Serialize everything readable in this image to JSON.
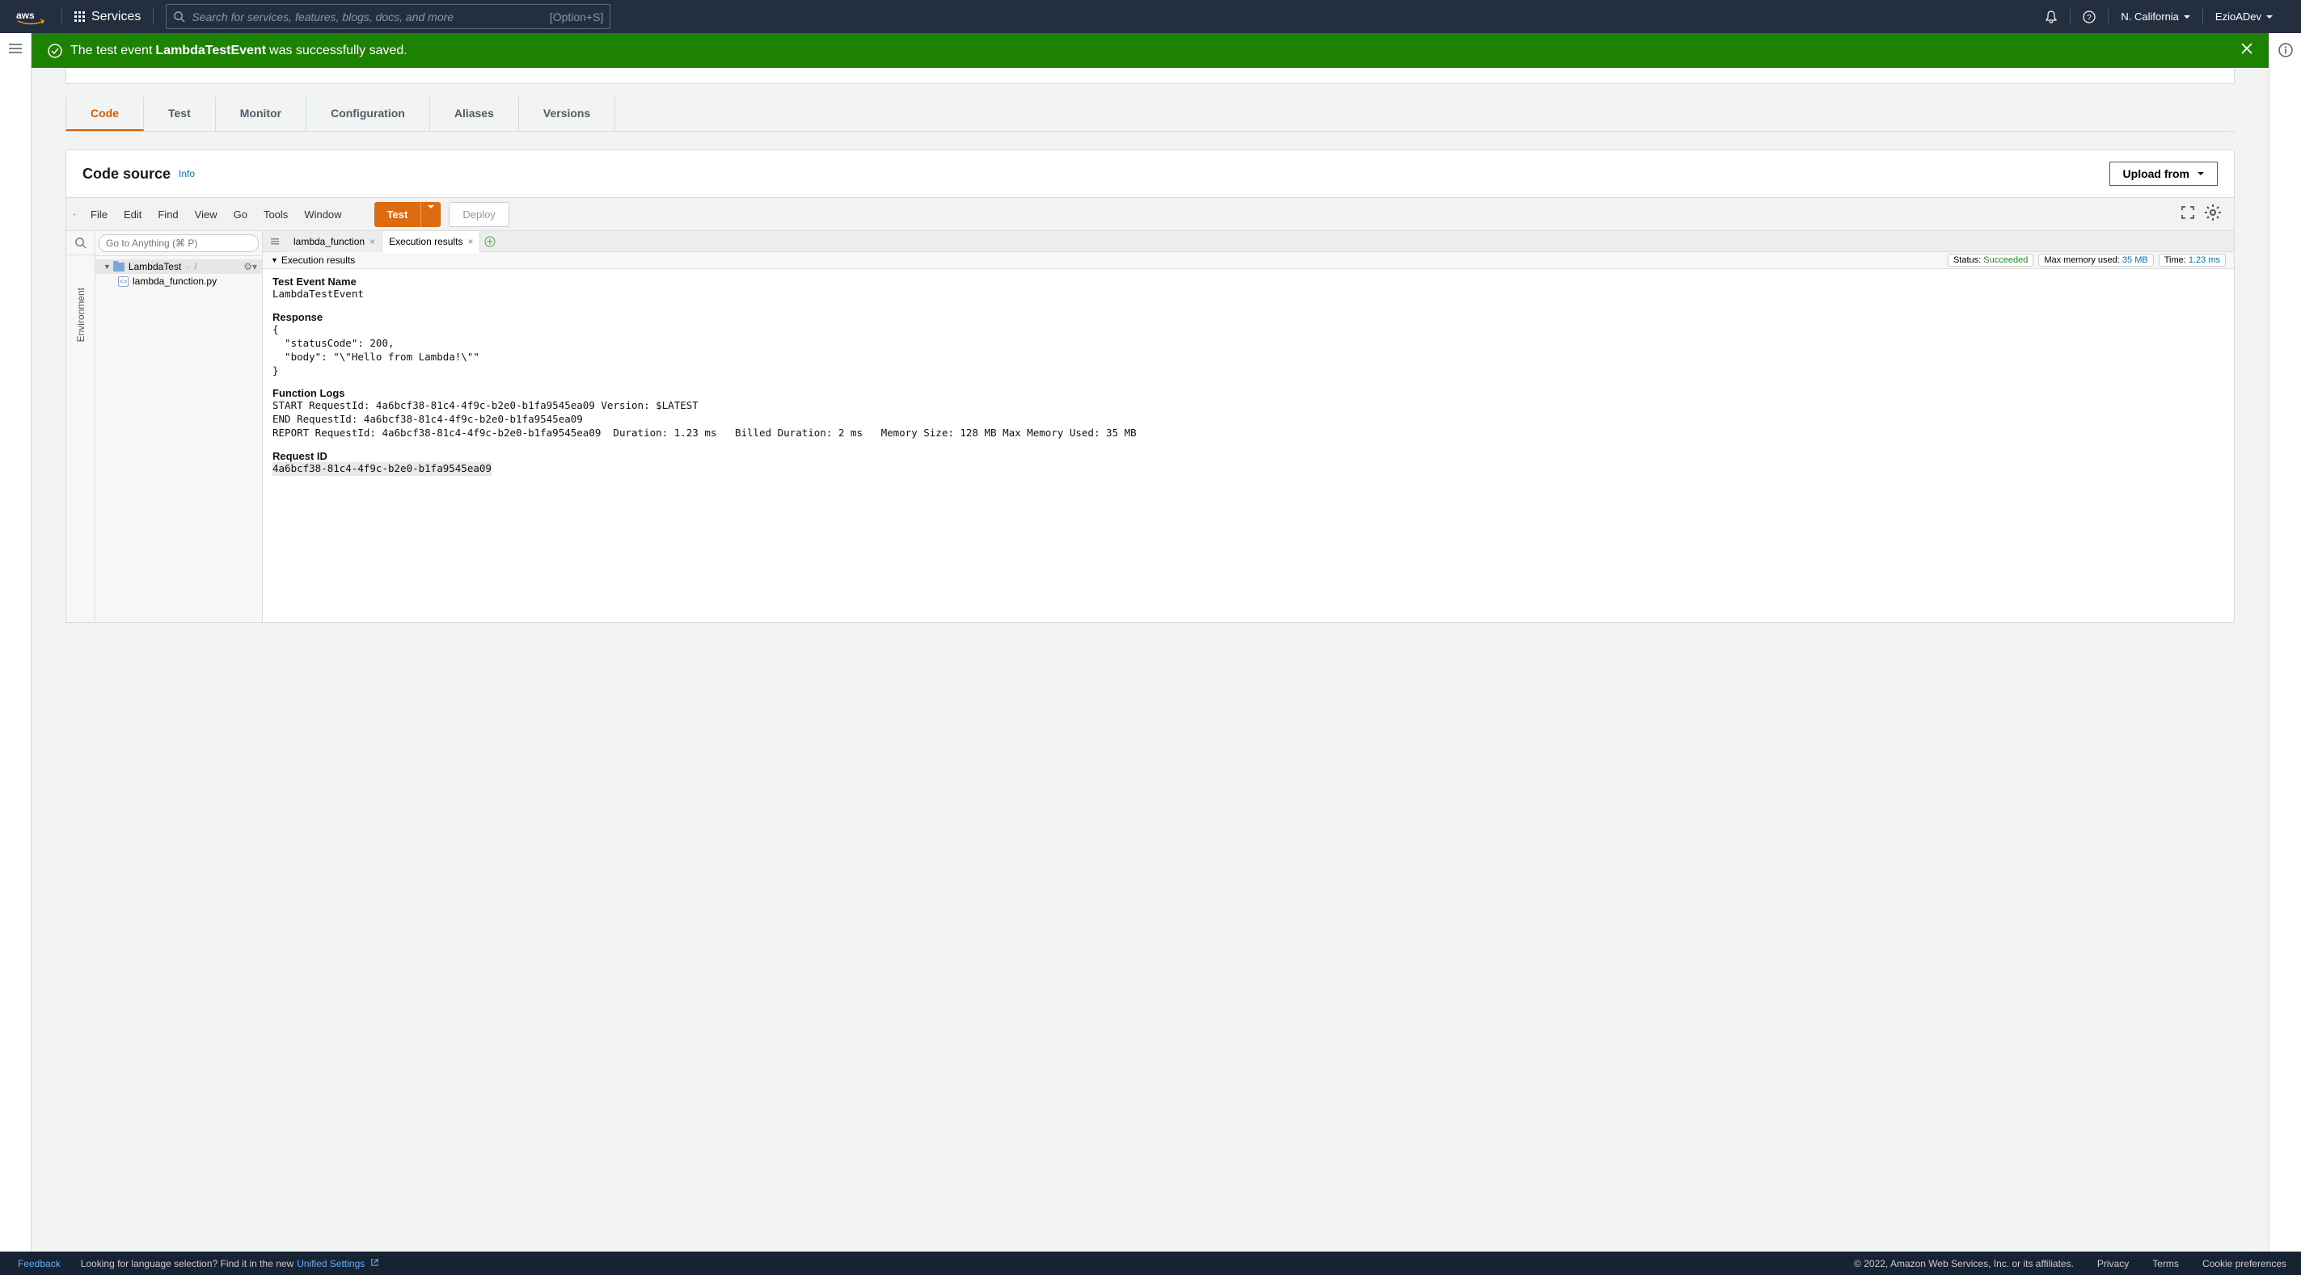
{
  "header": {
    "services_label": "Services",
    "search_placeholder": "Search for services, features, blogs, docs, and more",
    "search_shortcut": "[Option+S]",
    "region": "N. California",
    "account": "EzioADev"
  },
  "flash": {
    "prefix": "The test event ",
    "event_name": "LambdaTestEvent",
    "suffix": " was successfully saved."
  },
  "tabs": {
    "items": [
      "Code",
      "Test",
      "Monitor",
      "Configuration",
      "Aliases",
      "Versions"
    ],
    "active_index": 0
  },
  "code_source": {
    "title": "Code source",
    "info_label": "Info",
    "upload_label": "Upload from"
  },
  "ide": {
    "menu": [
      "File",
      "Edit",
      "Find",
      "View",
      "Go",
      "Tools",
      "Window"
    ],
    "test_label": "Test",
    "deploy_label": "Deploy",
    "tree": {
      "goto_placeholder": "Go to Anything (⌘ P)",
      "root_name": "LambdaTest",
      "root_sep": "/",
      "file_name": "lambda_function.py"
    },
    "env_label": "Environment",
    "editor_tabs": {
      "file_tab": "lambda_function",
      "results_tab": "Execution results"
    },
    "exec": {
      "header_label": "Execution results",
      "status_prefix": "Status:",
      "status_value": "Succeeded",
      "mem_prefix": "Max memory used:",
      "mem_value": "35 MB",
      "time_prefix": "Time:",
      "time_value": "1.23 ms",
      "test_event_label": "Test Event Name",
      "test_event_value": "LambdaTestEvent",
      "response_label": "Response",
      "response_body": "{\n  \"statusCode\": 200,\n  \"body\": \"\\\"Hello from Lambda!\\\"\"\n}",
      "logs_label": "Function Logs",
      "logs_body": "START RequestId: 4a6bcf38-81c4-4f9c-b2e0-b1fa9545ea09 Version: $LATEST\nEND RequestId: 4a6bcf38-81c4-4f9c-b2e0-b1fa9545ea09\nREPORT RequestId: 4a6bcf38-81c4-4f9c-b2e0-b1fa9545ea09  Duration: 1.23 ms   Billed Duration: 2 ms   Memory Size: 128 MB Max Memory Used: 35 MB",
      "reqid_label": "Request ID",
      "reqid_value": "4a6bcf38-81c4-4f9c-b2e0-b1fa9545ea09"
    }
  },
  "footer": {
    "feedback": "Feedback",
    "lang_prefix": "Looking for language selection? Find it in the new ",
    "lang_link": "Unified Settings",
    "copyright": "© 2022, Amazon Web Services, Inc. or its affiliates.",
    "privacy": "Privacy",
    "terms": "Terms",
    "cookies": "Cookie preferences"
  }
}
